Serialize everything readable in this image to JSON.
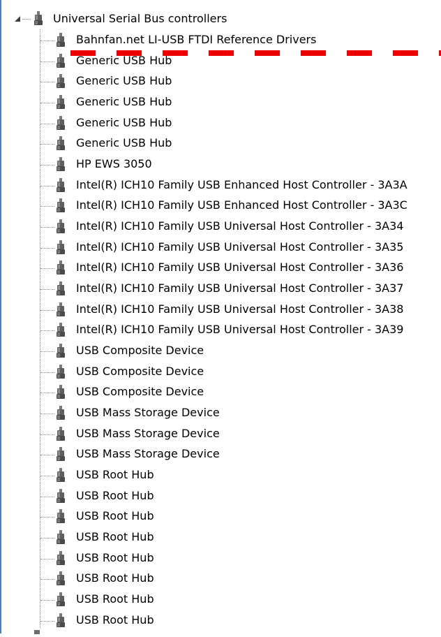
{
  "tree": {
    "category": {
      "label": "Universal Serial Bus controllers",
      "icon": "usb-plug-icon",
      "expanded": true
    },
    "devices": [
      "Bahnfan.net LI-USB FTDI Reference Drivers",
      "Generic USB Hub",
      "Generic USB Hub",
      "Generic USB Hub",
      "Generic USB Hub",
      "Generic USB Hub",
      "HP EWS 3050",
      "Intel(R) ICH10 Family USB Enhanced Host Controller - 3A3A",
      "Intel(R) ICH10 Family USB Enhanced Host Controller - 3A3C",
      "Intel(R) ICH10 Family USB Universal Host Controller - 3A34",
      "Intel(R) ICH10 Family USB Universal Host Controller - 3A35",
      "Intel(R) ICH10 Family USB Universal Host Controller - 3A36",
      "Intel(R) ICH10 Family USB Universal Host Controller - 3A37",
      "Intel(R) ICH10 Family USB Universal Host Controller - 3A38",
      "Intel(R) ICH10 Family USB Universal Host Controller - 3A39",
      "USB Composite Device",
      "USB Composite Device",
      "USB Composite Device",
      "USB Mass Storage Device",
      "USB Mass Storage Device",
      "USB Mass Storage Device",
      "USB Root Hub",
      "USB Root Hub",
      "USB Root Hub",
      "USB Root Hub",
      "USB Root Hub",
      "USB Root Hub",
      "USB Root Hub",
      "USB Root Hub"
    ]
  },
  "colors": {
    "annotation": "#ee0000",
    "frame": "#4a7cc7",
    "icon": "#555555"
  }
}
